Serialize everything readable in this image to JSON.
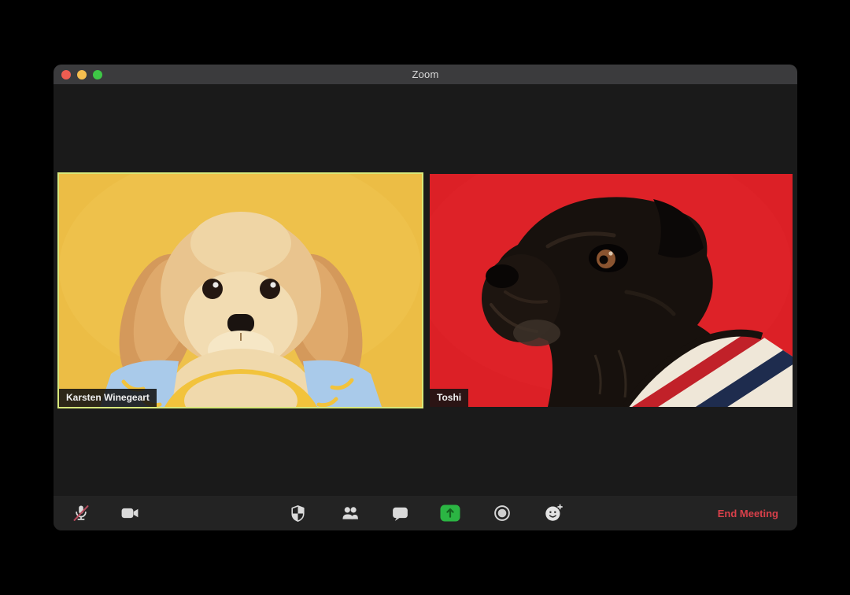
{
  "window": {
    "title": "Zoom",
    "controls": [
      {
        "icon": "close-traffic-light"
      },
      {
        "icon": "minimize-traffic-light"
      },
      {
        "icon": "fullscreen-traffic-light"
      }
    ]
  },
  "participants": [
    {
      "name": "Karsten Winegeart",
      "active_speaker": true,
      "video_desc": "cream fluffy puppy in blue banana shirt on yellow background"
    },
    {
      "name": "Toshi",
      "active_speaker": false,
      "video_desc": "black pug in navy-red striped outfit on red background"
    }
  ],
  "toolbar": {
    "buttons": [
      {
        "icon": "microphone-muted-icon",
        "state": "muted"
      },
      {
        "icon": "video-camera-icon",
        "state": "on"
      },
      {
        "icon": "security-shield-icon"
      },
      {
        "icon": "participants-icon"
      },
      {
        "icon": "chat-icon"
      },
      {
        "icon": "share-screen-icon"
      },
      {
        "icon": "record-icon"
      },
      {
        "icon": "reactions-icon"
      }
    ],
    "end_meeting_label": "End Meeting"
  },
  "colors": {
    "page_bg": "#000000",
    "window_bg": "#1A1A1A",
    "titlebar_bg": "#3B3B3D",
    "toolbar_bg": "#232323",
    "tl_red": "#EE5D51",
    "tl_yellow": "#F5BE4F",
    "tl_green": "#3EC746",
    "active_border": "#D7E87B",
    "tile_yellow": "#ECBD45",
    "tile_red": "#DC2026",
    "share_green": "#2BB543",
    "end_red": "#D8404A",
    "mute_slash": "#B2495A"
  }
}
